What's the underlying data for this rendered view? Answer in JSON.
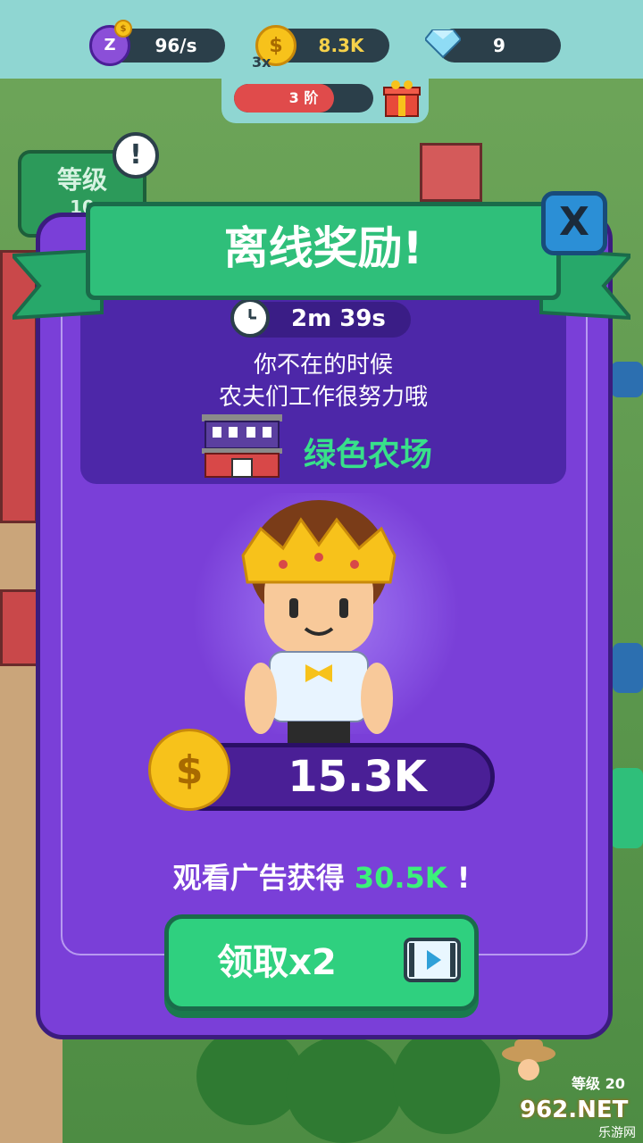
{
  "top_bar": {
    "idle_rate": "96/s",
    "idle_icon_text": "Z",
    "coins": "8.3K",
    "multiplier": "3x",
    "gems": "9",
    "stage_label": "3 阶",
    "stage_progress": 0.72
  },
  "background": {
    "level_badge_label": "等级",
    "level_badge_value": "10",
    "level_tag": "等级 20"
  },
  "dialog": {
    "title": "离线奖励!",
    "close_label": "X",
    "timer": "2m 39s",
    "message_line1": "你不在的时候",
    "message_line2": "农夫们工作很努力哦",
    "farm_name": "绿色农场",
    "reward_amount": "15.3K",
    "coin_symbol": "$",
    "watch_prefix": "观看广告获得 ",
    "watch_value": "30.5K",
    "watch_suffix": " !",
    "claim_label": "领取x2"
  },
  "watermark": {
    "text": "962.NET",
    "sub": "乐游网"
  },
  "colors": {
    "dialog_bg": "#7a3fd8",
    "ribbon": "#2fbf7a",
    "claim_button": "#2fd07f",
    "highlight_green": "#3cf07a",
    "stage_bar": "#e04b4b"
  }
}
